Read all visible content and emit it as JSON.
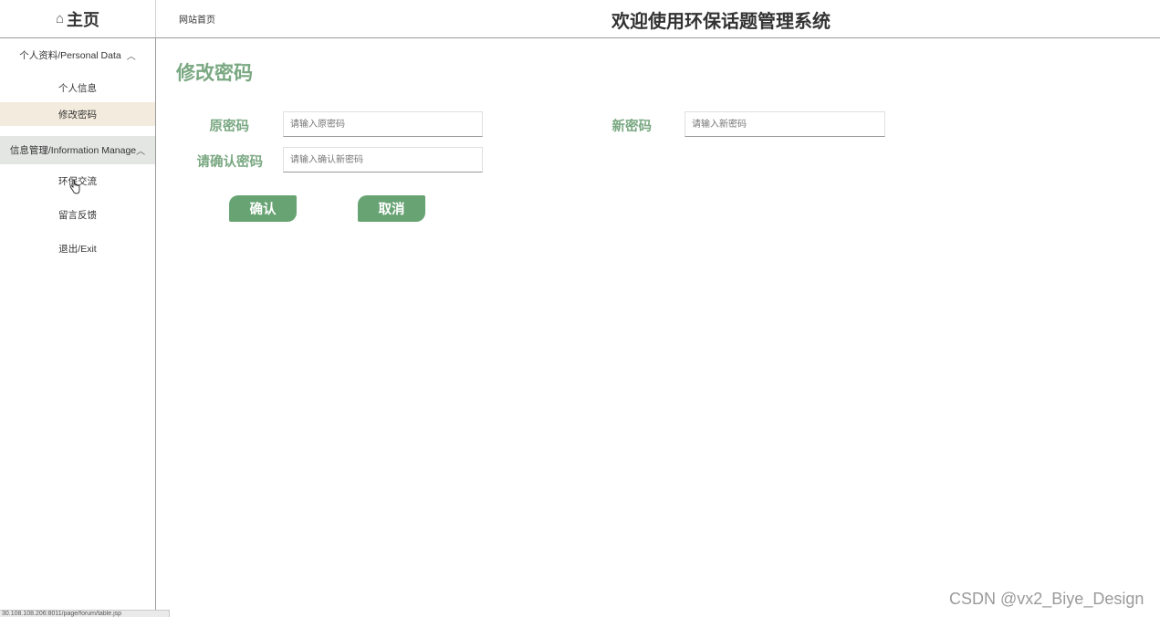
{
  "header": {
    "home_label": "主页",
    "home_icon": "⌂",
    "site_home_link": "网站首页",
    "site_title": "欢迎使用环保话题管理系统"
  },
  "sidebar": {
    "group1_label": "个人资料/Personal Data",
    "group1_chevron": "︿",
    "items1": [
      {
        "label": "个人信息"
      },
      {
        "label": "修改密码"
      }
    ],
    "group2_label": "信息管理/Information Manage",
    "group2_chevron": "︿",
    "items2": [
      {
        "label": "环保交流"
      },
      {
        "label": "留言反馈"
      },
      {
        "label": "退出/Exit"
      }
    ]
  },
  "form": {
    "page_title": "修改密码",
    "old_password_label": "原密码",
    "old_password_placeholder": "请输入原密码",
    "new_password_label": "新密码",
    "new_password_placeholder": "请输入新密码",
    "confirm_password_label": "请确认密码",
    "confirm_password_placeholder": "请输入确认新密码",
    "confirm_button": "确认",
    "cancel_button": "取消"
  },
  "watermark": "CSDN @vx2_Biye_Design",
  "statusbar_url": "30.108.108.206:8011/page/forum/table.jsp",
  "colors": {
    "accent_green": "#7aa882",
    "button_green": "#68a373",
    "active_item_bg": "#f3ebdd",
    "group_header_bg": "#e4e6e4"
  }
}
